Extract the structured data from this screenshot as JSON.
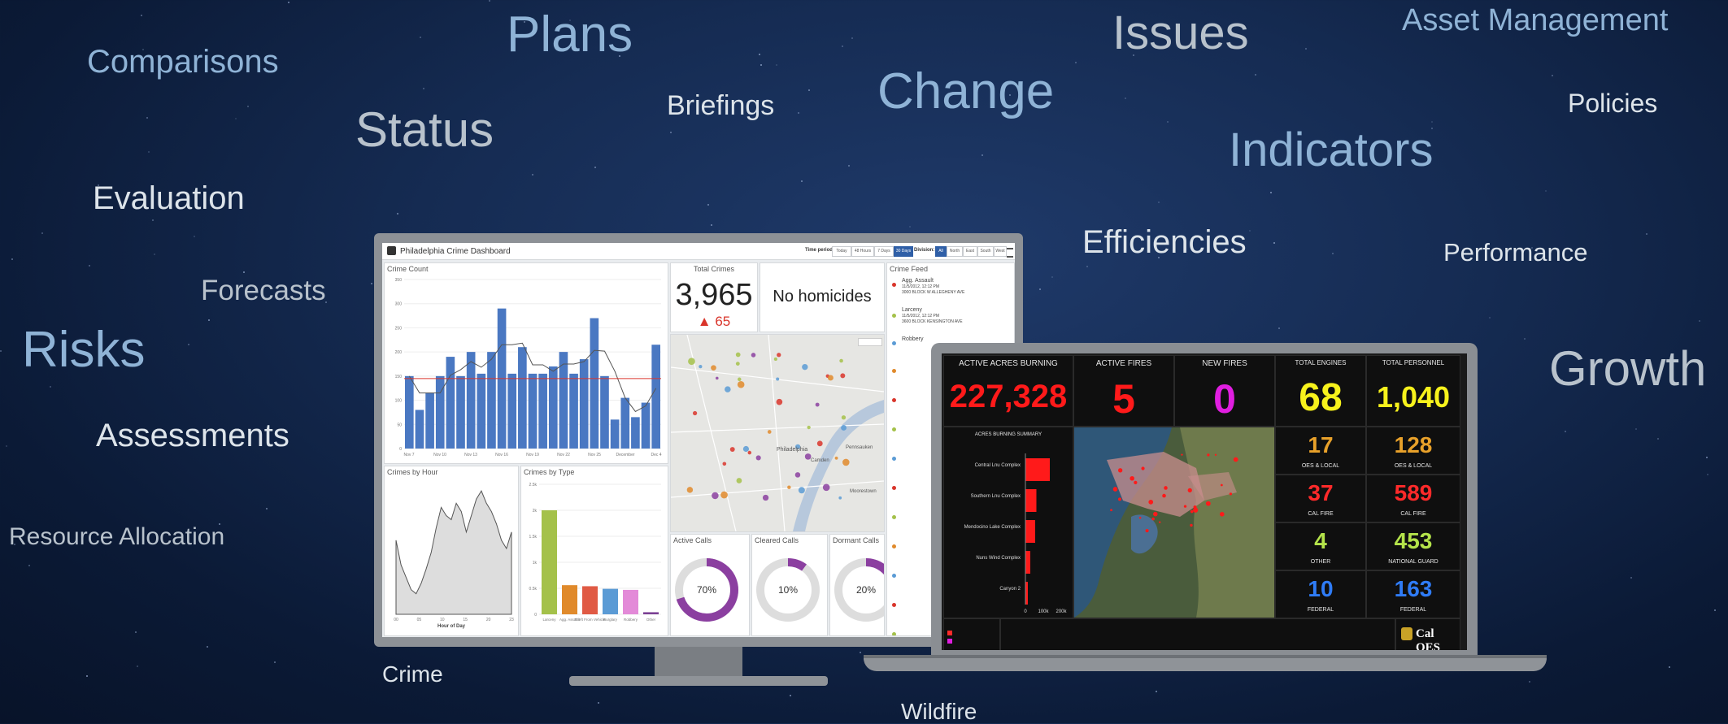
{
  "background_words": [
    {
      "id": "comparisons",
      "text": "Comparisons"
    },
    {
      "id": "plans",
      "text": "Plans"
    },
    {
      "id": "issues",
      "text": "Issues"
    },
    {
      "id": "asset-management",
      "text": "Asset Management"
    },
    {
      "id": "status",
      "text": "Status"
    },
    {
      "id": "briefings",
      "text": "Briefings"
    },
    {
      "id": "change",
      "text": "Change"
    },
    {
      "id": "policies",
      "text": "Policies"
    },
    {
      "id": "indicators",
      "text": "Indicators"
    },
    {
      "id": "evaluation",
      "text": "Evaluation"
    },
    {
      "id": "efficiencies",
      "text": "Efficiencies"
    },
    {
      "id": "performance",
      "text": "Performance"
    },
    {
      "id": "forecasts",
      "text": "Forecasts"
    },
    {
      "id": "risks",
      "text": "Risks"
    },
    {
      "id": "growth",
      "text": "Growth"
    },
    {
      "id": "assessments",
      "text": "Assessments"
    },
    {
      "id": "resource-allocation",
      "text": "Resource Allocation"
    }
  ],
  "captions": {
    "crime": "Crime",
    "wildfire": "Wildfire"
  },
  "crime_dashboard": {
    "title": "Philadelphia Crime Dashboard",
    "time_period_label": "Time period:",
    "time_period_options": [
      "Today",
      "48 Hours",
      "7 Days",
      "30 Days"
    ],
    "time_period_selected": "30 Days",
    "division_label": "Division:",
    "division_options": [
      "All",
      "North",
      "East",
      "South",
      "West"
    ],
    "division_selected": "All",
    "crime_count": {
      "title": "Crime Count",
      "y_ticks": [
        "350",
        "300",
        "250",
        "200",
        "150",
        "100",
        "50",
        "0"
      ],
      "x_ticks": [
        "Nov 7",
        "Nov 10",
        "Nov 13",
        "Nov 16",
        "Nov 19",
        "Nov 22",
        "Nov 25",
        "December",
        "Dec 4"
      ],
      "values": [
        150,
        80,
        115,
        150,
        190,
        150,
        200,
        155,
        200,
        290,
        155,
        210,
        155,
        155,
        170,
        200,
        155,
        185,
        270,
        150,
        60,
        105,
        65,
        95,
        215
      ],
      "average": 145,
      "ylim": [
        0,
        350
      ]
    },
    "total_crimes": {
      "title": "Total Crimes",
      "value": "3,965",
      "delta": "▲ 65"
    },
    "homicides": {
      "text": "No homicides"
    },
    "crime_feed": {
      "title": "Crime Feed",
      "items": [
        {
          "type": "Agg. Assault",
          "time": "11/5/2012, 12:12 PM",
          "address": "3000 BLOCK W ALLEGHENY AVE"
        },
        {
          "type": "Larceny",
          "time": "11/5/2012, 12:12 PM",
          "address": "3600 BLOCK KENSINGTON AVE"
        },
        {
          "type": "Robbery",
          "time": "",
          "address": ""
        }
      ]
    },
    "map_labels": [
      "Philadelphia",
      "Camden",
      "Pennsauken",
      "Moorestown"
    ],
    "crimes_by_hour": {
      "title": "Crimes by Hour",
      "xlabel": "Hour of Day",
      "x_ticks": [
        "00",
        "05",
        "10",
        "15",
        "20",
        "23"
      ],
      "values": [
        180,
        120,
        90,
        60,
        50,
        75,
        110,
        150,
        210,
        260,
        240,
        230,
        270,
        250,
        200,
        240,
        280,
        300,
        270,
        250,
        220,
        180,
        160,
        200
      ]
    },
    "crimes_by_type": {
      "title": "Crimes by Type",
      "y_ticks": [
        "2.5k",
        "2k",
        "1.5k",
        "1k",
        "0.5k",
        "0"
      ],
      "categories": [
        "Larceny",
        "Agg. Assault",
        "Theft From Vehicle",
        "Burglary",
        "Robbery",
        "Other"
      ],
      "values": [
        2000,
        560,
        540,
        490,
        470,
        40
      ],
      "colors": [
        "#a4c14a",
        "#e08a2b",
        "#e05a44",
        "#5b9bd5",
        "#e38ad8",
        "#7a3f93"
      ]
    },
    "active_calls": {
      "title": "Active Calls",
      "percent": 70,
      "label": "70%"
    },
    "cleared_calls": {
      "title": "Cleared Calls",
      "percent": 10,
      "label": "10%"
    },
    "dormant_calls": {
      "title": "Dormant Calls",
      "percent": 20,
      "label": "20%"
    }
  },
  "wildfire_dashboard": {
    "active_acres": {
      "label": "ACTIVE ACRES BURNING",
      "value": "227,328",
      "color": "#ff1a1a"
    },
    "active_fires": {
      "label": "ACTIVE FIRES",
      "value": "5",
      "color": "#ff1a1a"
    },
    "new_fires": {
      "label": "NEW FIRES",
      "value": "0",
      "color": "#e01ee0"
    },
    "total_engines": {
      "label": "TOTAL ENGINES",
      "value": "68",
      "color": "#f7f21c"
    },
    "total_personnel": {
      "label": "TOTAL PERSONNEL",
      "value": "1,040",
      "color": "#f7f21c"
    },
    "acres_summary": {
      "title": "ACRES BURNING SUMMARY",
      "items": [
        {
          "name": "Central Lnu Complex",
          "value": 1.0
        },
        {
          "name": "Southern Lnu Complex",
          "value": 0.45
        },
        {
          "name": "Mendocino Lake Complex",
          "value": 0.4
        },
        {
          "name": "Nuns Wind Complex",
          "value": 0.2
        },
        {
          "name": "Canyon 2",
          "value": 0.08
        }
      ],
      "x_ticks": [
        "0",
        "100k",
        "200k"
      ]
    },
    "engines_breakdown": [
      {
        "value": "17",
        "label": "OES & LOCAL",
        "color": "#e8a12a"
      },
      {
        "value": "37",
        "label": "CAL FIRE",
        "color": "#ff2a2a"
      },
      {
        "value": "4",
        "label": "OTHER",
        "color": "#b4e34a"
      },
      {
        "value": "10",
        "label": "FEDERAL",
        "color": "#2f7cf7"
      }
    ],
    "personnel_breakdown": [
      {
        "value": "128",
        "label": "OES & LOCAL",
        "color": "#e8a12a"
      },
      {
        "value": "589",
        "label": "CAL FIRE",
        "color": "#ff2a2a"
      },
      {
        "value": "453",
        "label": "NATIONAL GUARD",
        "color": "#b4e34a"
      },
      {
        "value": "163",
        "label": "FEDERAL",
        "color": "#2f7cf7"
      }
    ],
    "logo_text": "Cal OES"
  }
}
